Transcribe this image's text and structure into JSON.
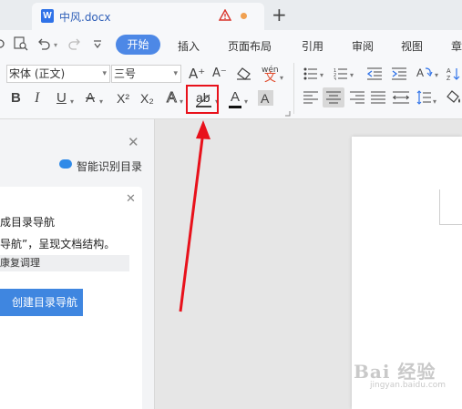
{
  "tabbar": {
    "doc_title": "中风.docx",
    "new_tab": "+"
  },
  "menubar": {
    "tabs": [
      "开始",
      "插入",
      "页面布局",
      "引用",
      "审阅",
      "视图",
      "章"
    ]
  },
  "ribbon": {
    "font_name": "宋体 (正文)",
    "font_size": "三号",
    "grow_font": "A⁺",
    "shrink_font": "A⁻",
    "clear_format": "◇",
    "phonetic": "wén",
    "bold": "B",
    "italic": "I",
    "underline": "U",
    "strikethrough": "A",
    "superscript": "X²",
    "subscript": "X₂",
    "text_effect": "A",
    "highlight": "ab",
    "font_color": "A",
    "char_shading": "A",
    "caret": "▾"
  },
  "leftpane": {
    "close": "✕",
    "smart_toc": "智能识别目录",
    "card_close": "✕",
    "line1": "成目录导航",
    "line2": "导航”，呈现文档结构。",
    "field_value": "康复调理",
    "button": "创建目录导航"
  },
  "watermark": {
    "main": "Bai 经验",
    "sub": "jingyan.baidu.com"
  },
  "colors": {
    "accent": "#4d88e6",
    "annotation": "#e8111b",
    "button": "#3f86e0"
  }
}
